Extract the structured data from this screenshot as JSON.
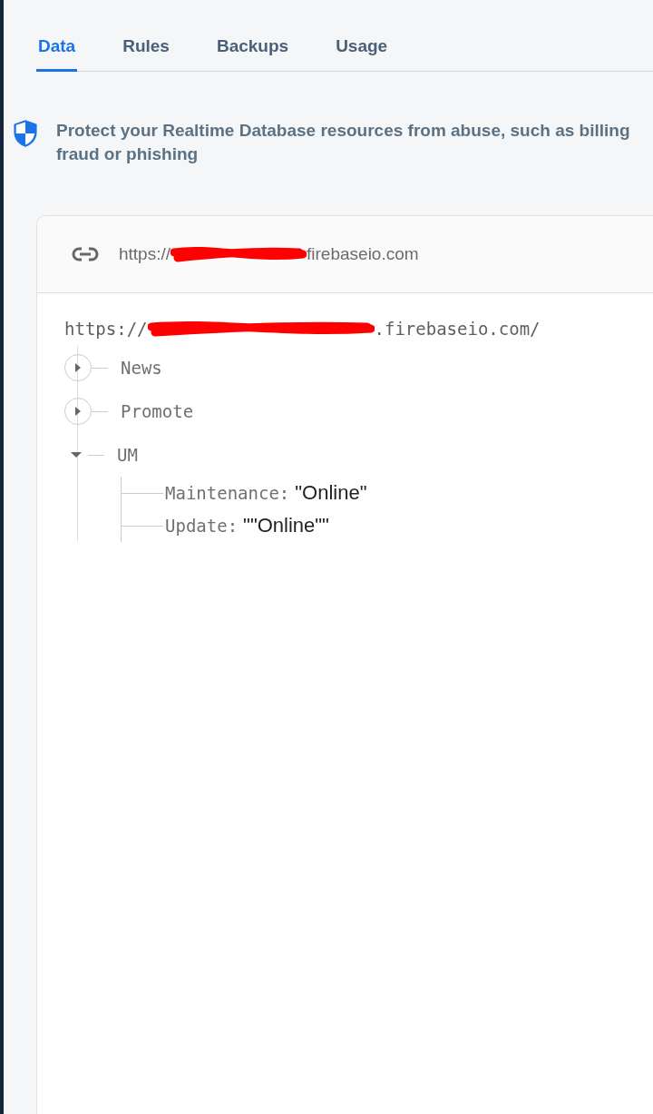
{
  "tabs": [
    {
      "label": "Data",
      "selected": true
    },
    {
      "label": "Rules",
      "selected": false
    },
    {
      "label": "Backups",
      "selected": false
    },
    {
      "label": "Usage",
      "selected": false
    }
  ],
  "notice": {
    "text": "Protect your Realtime Database resources from abuse, such as billing fraud or phishing"
  },
  "database": {
    "url_start": "https://",
    "url_end": "firebaseio.com",
    "root_start": "https://",
    "root_end": ".firebaseio.com/",
    "nodes": [
      {
        "key": "News",
        "expanded": false
      },
      {
        "key": "Promote",
        "expanded": false
      },
      {
        "key": "UM",
        "expanded": true,
        "children": [
          {
            "key": "Maintenance:",
            "value": "\"Online\""
          },
          {
            "key": "Update:",
            "value": "\"\"Online\"\""
          }
        ]
      }
    ]
  }
}
